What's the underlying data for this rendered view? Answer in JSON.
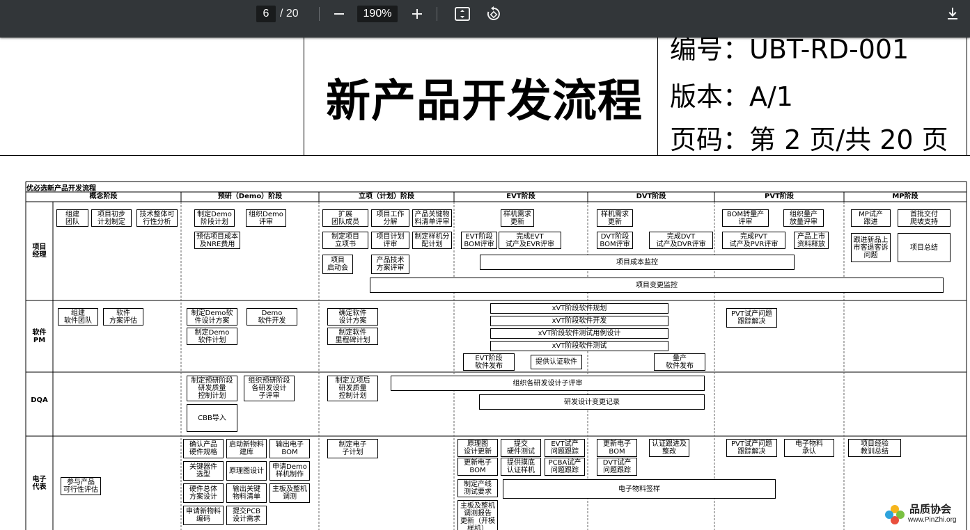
{
  "toolbar": {
    "current_page": "6",
    "total_pages": "/ 20",
    "zoom": "190%",
    "icons": [
      "minus-icon",
      "plus-icon",
      "fit-page-icon",
      "rotate-icon",
      "download-icon"
    ]
  },
  "header": {
    "title": "新产品开发流程",
    "number_line": "编号：UBT-RD-001",
    "version_line": "版本：A/1",
    "page_line": "页码：第 2 页/共 20 页"
  },
  "flow": {
    "title": "优必选新产品开发流程",
    "phases": [
      "概念阶段",
      "预研（Demo）阶段",
      "立项（计划）阶段",
      "EVT阶段",
      "DVT阶段",
      "PVT阶段",
      "MP阶段"
    ],
    "roles": [
      "项目\n经理",
      "软件\nPM",
      "DQA",
      "电子\n代表"
    ],
    "boxes": [
      "组建\n团队",
      "项目初步\n计划制定",
      "技术整体可\n行性分析",
      "制定Demo\n阶段计划",
      "组织Demo\n评审",
      "预估项目成本\n及NRE费用",
      "扩展\n团队成员",
      "项目工作\n分解",
      "产品关键物\n料清单评审",
      "制定项目\n立项书",
      "项目计划\n评审",
      "制定样机分\n配计划",
      "项目\n启动会",
      "产品技术\n方案评审",
      "样机需求\n更新",
      "EVT阶段\nBOM评审",
      "完成EVT\n试产及EVR评审",
      "样机需求\n更新",
      "DVT阶段\nBOM评审",
      "完成DVT\n试产及DVR评审",
      "BOM转量产\n评审",
      "组织量产\n放量评审",
      "完成PVT\n试产及PVR评审",
      "产品上市\n资料释放",
      "MP试产\n跟进",
      "首批交付\n爬坡支持",
      "跟进新品上\n市客退客诉\n问题",
      "项目总结",
      "项目成本监控",
      "项目变更监控",
      "组建\n软件团队",
      "软件\n方案评估",
      "制定Demo软\n件设计方案",
      "Demo\n软件开发",
      "制定Demo\n软件计划",
      "确定软件\n设计方案",
      "制定软件\n里程碑计划",
      "xVT阶段软件规划",
      "xVT阶段软件开发",
      "xVT阶段软件测试用例设计",
      "xVT阶段软件测试",
      "EVT阶段\n软件发布",
      "提供认证软件",
      "量产\n软件发布",
      "PVT试产问题\n跟踪解决",
      "制定预研阶段\n研发质量\n控制计划",
      "组织预研阶段\n各研发设计\n子评审",
      "CBB导入",
      "制定立项后\n研发质量\n控制计划",
      "组织各研发设计子评审",
      "研发设计变更记录",
      "参与产品\n可行性评估",
      "确认产品\n硬件规格",
      "启动新物料\n建库",
      "输出电子\nBOM",
      "关键器件\n选型",
      "原理图设计",
      "申请Demo\n样机制作",
      "硬件总体\n方案设计",
      "输出关键\n物料清单",
      "主板及整机\n调测",
      "申请新物料\n编码",
      "提交PCB\n设计需求",
      "制定电子\n子计划",
      "原理图\n设计更新",
      "提交\n硬件测试",
      "EVT试产\n问题跟踪",
      "更新电子\nBOM",
      "提供摸底\n认证样机",
      "PCBA试产\n问题跟踪",
      "制定产线\n测试要求",
      "电子物料签样",
      "主板及整机\n调测报告\n更新（开模\n样机）",
      "更新电子\nBOM",
      "认证跟进及\n整改",
      "DVT试产\n问题跟踪",
      "PVT试产问题\n跟踪解决",
      "电子物料\n承认",
      "项目经验\n教训总结"
    ]
  },
  "watermark": {
    "name": "品质协会",
    "url": "www.PinZhi.org"
  }
}
